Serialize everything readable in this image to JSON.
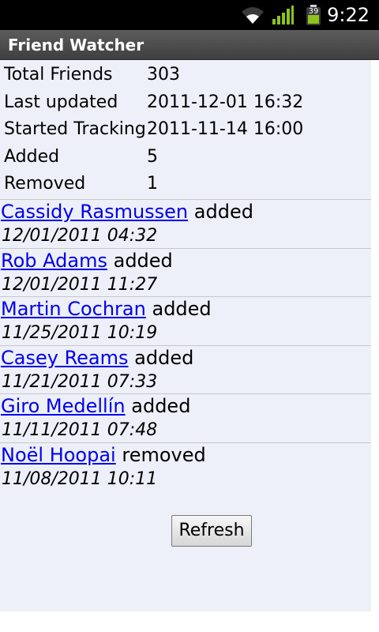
{
  "status_bar": {
    "time": "9:22",
    "battery_level": "39",
    "icons": [
      "wifi-icon",
      "signal-icon",
      "battery-icon"
    ]
  },
  "app": {
    "title": "Friend Watcher"
  },
  "stats": [
    {
      "label": "Total Friends",
      "value": "303"
    },
    {
      "label": "Last updated",
      "value": "2011-12-01 16:32"
    },
    {
      "label": "Started Tracking",
      "value": "2011-11-14 16:00"
    },
    {
      "label": "Added",
      "value": "5"
    },
    {
      "label": "Removed",
      "value": "1"
    }
  ],
  "events": [
    {
      "name": "Cassidy Rasmussen",
      "action": "added",
      "date": "12/01/2011 04:32"
    },
    {
      "name": "Rob Adams",
      "action": "added",
      "date": "12/01/2011 11:27"
    },
    {
      "name": "Martin Cochran",
      "action": "added",
      "date": "11/25/2011 10:19"
    },
    {
      "name": "Casey Reams",
      "action": "added",
      "date": "11/21/2011 07:33"
    },
    {
      "name": "Giro Medellín",
      "action": "added",
      "date": "11/11/2011 07:48"
    },
    {
      "name": "Noël Hoopai",
      "action": "removed",
      "date": "11/08/2011 10:11"
    }
  ],
  "refresh_button": {
    "label": "Refresh"
  },
  "colors": {
    "link": "#0000ee",
    "content_background": "#edf0f8",
    "title_bar": "#4a4a4a",
    "status_bar": "#000000"
  }
}
